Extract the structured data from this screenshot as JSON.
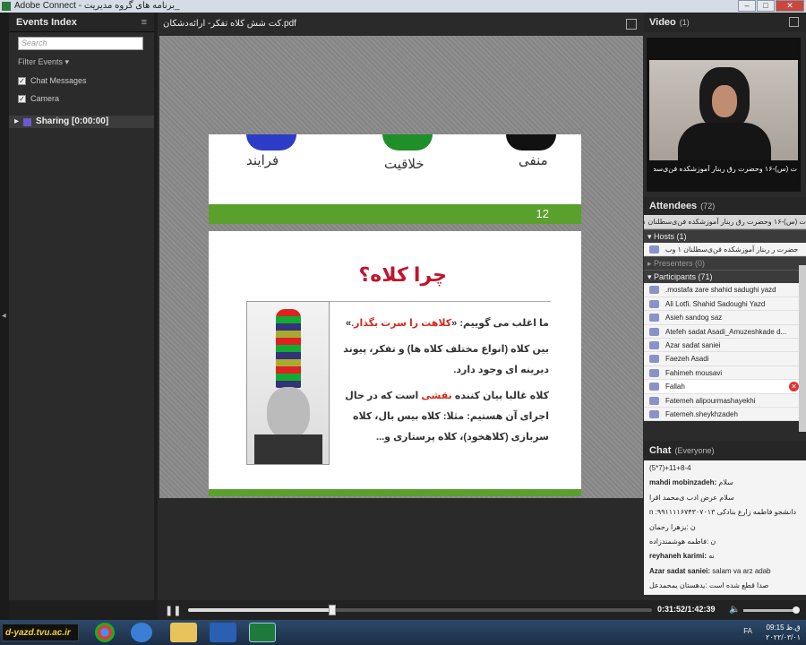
{
  "window": {
    "title": "Adobe Connect - برنامه های گروه مدیریت_"
  },
  "events": {
    "title": "Events Index",
    "menu_icon": "≡",
    "search_placeholder": "Search",
    "filter_label": "Filter Events",
    "options": [
      {
        "label": "Chat Messages",
        "checked": true
      },
      {
        "label": "Camera",
        "checked": true
      }
    ],
    "sharing_label": "Sharing [0:00:00]"
  },
  "document": {
    "filename": "کت شش کلاه تفکر- ارائه‌دشکان.pdf",
    "slide1": {
      "labels": [
        "فرایند",
        "خلاقیت",
        "منفی"
      ],
      "page_number": "12"
    },
    "slide2": {
      "title": "چرا کلاه؟",
      "p1_prefix": "ما اغلب می گوییم: «",
      "p1_highlight": "کلاهت را سرت بگذار.",
      "p1_suffix": "»",
      "p2": "بین کلاه (انواع مختلف کلاه ها) و تفکر، پیوند دیرینه ای وجود دارد.",
      "p3_prefix": "کلاه غالبا بیان کننده ",
      "p3_highlight": "نقشی",
      "p3_suffix": " است که در حال اجرای آن هستیم: مثلا: کلاه بیس بال، کلاه سربازی (کلاهخود)، کلاه پرستاری و..."
    }
  },
  "video": {
    "title": "Video",
    "count": "(1)",
    "caption": "ت (س)-۱۶ وحضرت رق ربنار آموزشکده فن‌ی‌سطلنان ۱ وب"
  },
  "attendees": {
    "title": "Attendees",
    "count": "(72)",
    "current_user": "ت (س)-۱۶ وحضرت رق ربنار آموزشکده فن‌ی‌سطلنان ۱ وب",
    "hosts_label": "Hosts (1)",
    "host_name": "حضرت ر ربنار آموزشکده فن‌ی‌سطلنان ۱ وب",
    "presenters_label": "Presenters (0)",
    "participants_label": "Participants (71)",
    "participants": [
      ".mostafa zare shahid sadughi yazd",
      "Ali Lotfi. Shahid Sadoughi Yazd",
      "Asieh sandog saz",
      "Atefeh sadat Asadi_Amuzeshkade d...",
      "Azar sadat saniei",
      "Faezeh Asadi",
      "Fahimeh mousavi",
      "Fallah",
      "Fatemeh alipourmashayekhi",
      "Fatemeh.sheykhzadeh"
    ]
  },
  "chat": {
    "title": "Chat",
    "scope": "(Everyone)",
    "messages": [
      {
        "sender": "",
        "text": "(5*7)+11+8-4"
      },
      {
        "sender": "mahdi mobinzadeh:",
        "text": " سلام"
      },
      {
        "sender": "",
        "text": "سلام عرض ادب ‌ی‌محمد اقرا"
      },
      {
        "sender": "",
        "text": "n :دانشجو فاطمه زارع بنادکی ۹۹۱۱۱۱۶۷۴۳۰۷۰۱۳"
      },
      {
        "sender": "",
        "text": "ن :یزهرا رحمان"
      },
      {
        "sender": "",
        "text": "ن :فاطمه هوشمندزاده"
      },
      {
        "sender": "reyhaneh karimi:",
        "text": " نه"
      },
      {
        "sender": "Azar sadat saniei:",
        "text": " salam va arz adab"
      },
      {
        "sender": "",
        "text": "صدا قطع شده است :یدهستان یمحمدعل"
      }
    ]
  },
  "playback": {
    "time": "0:31:52/1:42:39",
    "progress": 0.31
  },
  "taskbar": {
    "site": "d-yazd.tvu.ac.ir",
    "lang": "FA",
    "time": "09:15 ق.ظ",
    "date": "۲۰۲۲/۰۳/۰۱"
  }
}
